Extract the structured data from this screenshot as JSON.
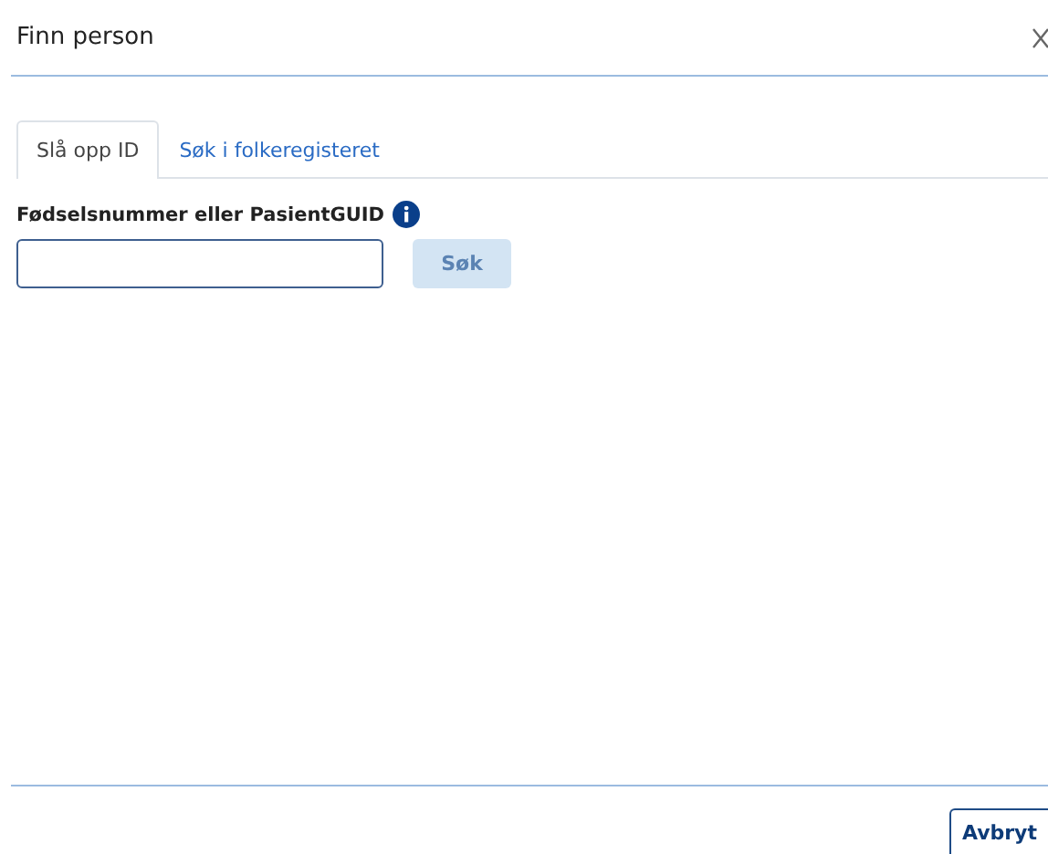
{
  "dialog": {
    "title": "Finn person"
  },
  "tabs": [
    {
      "label": "Slå opp ID",
      "selected": true
    },
    {
      "label": "Søk i folkeregisteret",
      "selected": false
    }
  ],
  "field": {
    "label": "Fødselsnummer eller PasientGUID"
  },
  "search_button": {
    "label": "Søk",
    "disabled": true
  },
  "footer": {
    "cancel_button": "Avbryt"
  }
}
